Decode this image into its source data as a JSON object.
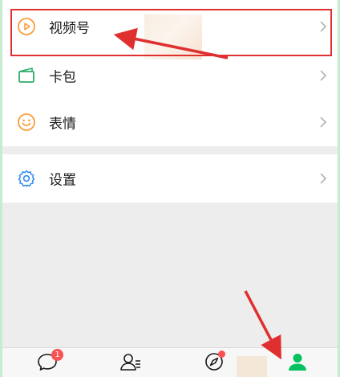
{
  "menu": {
    "items": [
      {
        "label": "视频号",
        "icon": "channels-icon",
        "icon_color": "#fa9d3b"
      },
      {
        "label": "卡包",
        "icon": "card-wallet-icon",
        "icon_color": "#2aae67"
      },
      {
        "label": "表情",
        "icon": "sticker-icon",
        "icon_color": "#fa9d3b"
      },
      {
        "label": "设置",
        "icon": "gear-icon",
        "icon_color": "#2d8cf0"
      }
    ]
  },
  "tabbar": {
    "chats_badge": "1",
    "active_color": "#07c160",
    "tabs": [
      {
        "icon": "chat-bubble-icon",
        "active": false
      },
      {
        "icon": "contacts-icon",
        "active": false
      },
      {
        "icon": "compass-icon",
        "active": false
      },
      {
        "icon": "person-icon",
        "active": true
      }
    ]
  },
  "annotations": {
    "color": "#e02f2f"
  }
}
